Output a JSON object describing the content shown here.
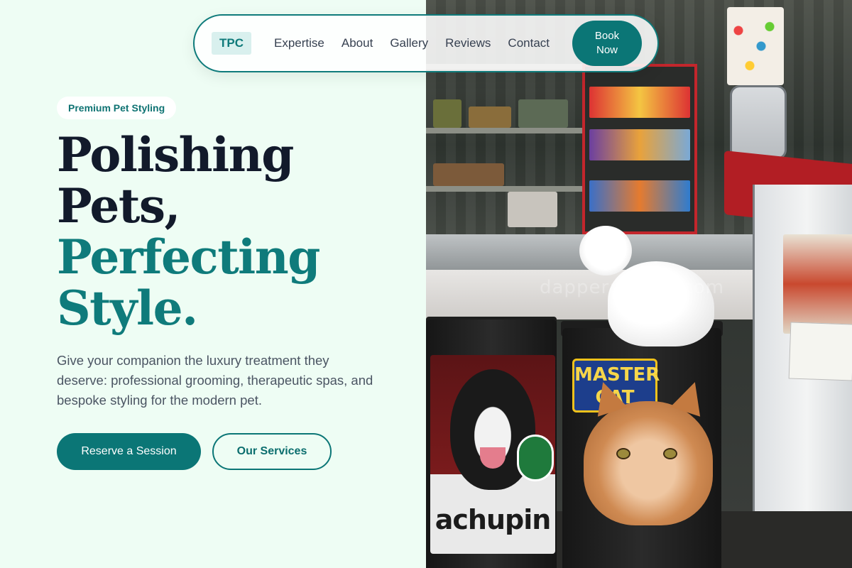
{
  "nav": {
    "logo": "TPC",
    "links": [
      "Expertise",
      "About",
      "Gallery",
      "Reviews",
      "Contact"
    ],
    "cta_line1": "Book",
    "cta_line2": "Now"
  },
  "hero": {
    "tag": "Premium Pet Styling",
    "headline_dark_1": "Polishing",
    "headline_dark_2": "Pets,",
    "headline_teal_1": "Perfecting",
    "headline_teal_2": "Style.",
    "lead": "Give your companion the luxury treatment they deserve: professional grooming, therapeutic spas, and bespoke styling for the modern pet.",
    "primary_cta": "Reserve a Session",
    "secondary_cta": "Our Services"
  },
  "photo": {
    "watermark": "dapperanimal.com",
    "bag_brand": "achupin",
    "label_brand_1": "MASTER",
    "label_brand_2": "CAT"
  },
  "colors": {
    "background": "#eefdf4",
    "accent": "#0b7676",
    "heading_dark": "#121a2b"
  }
}
